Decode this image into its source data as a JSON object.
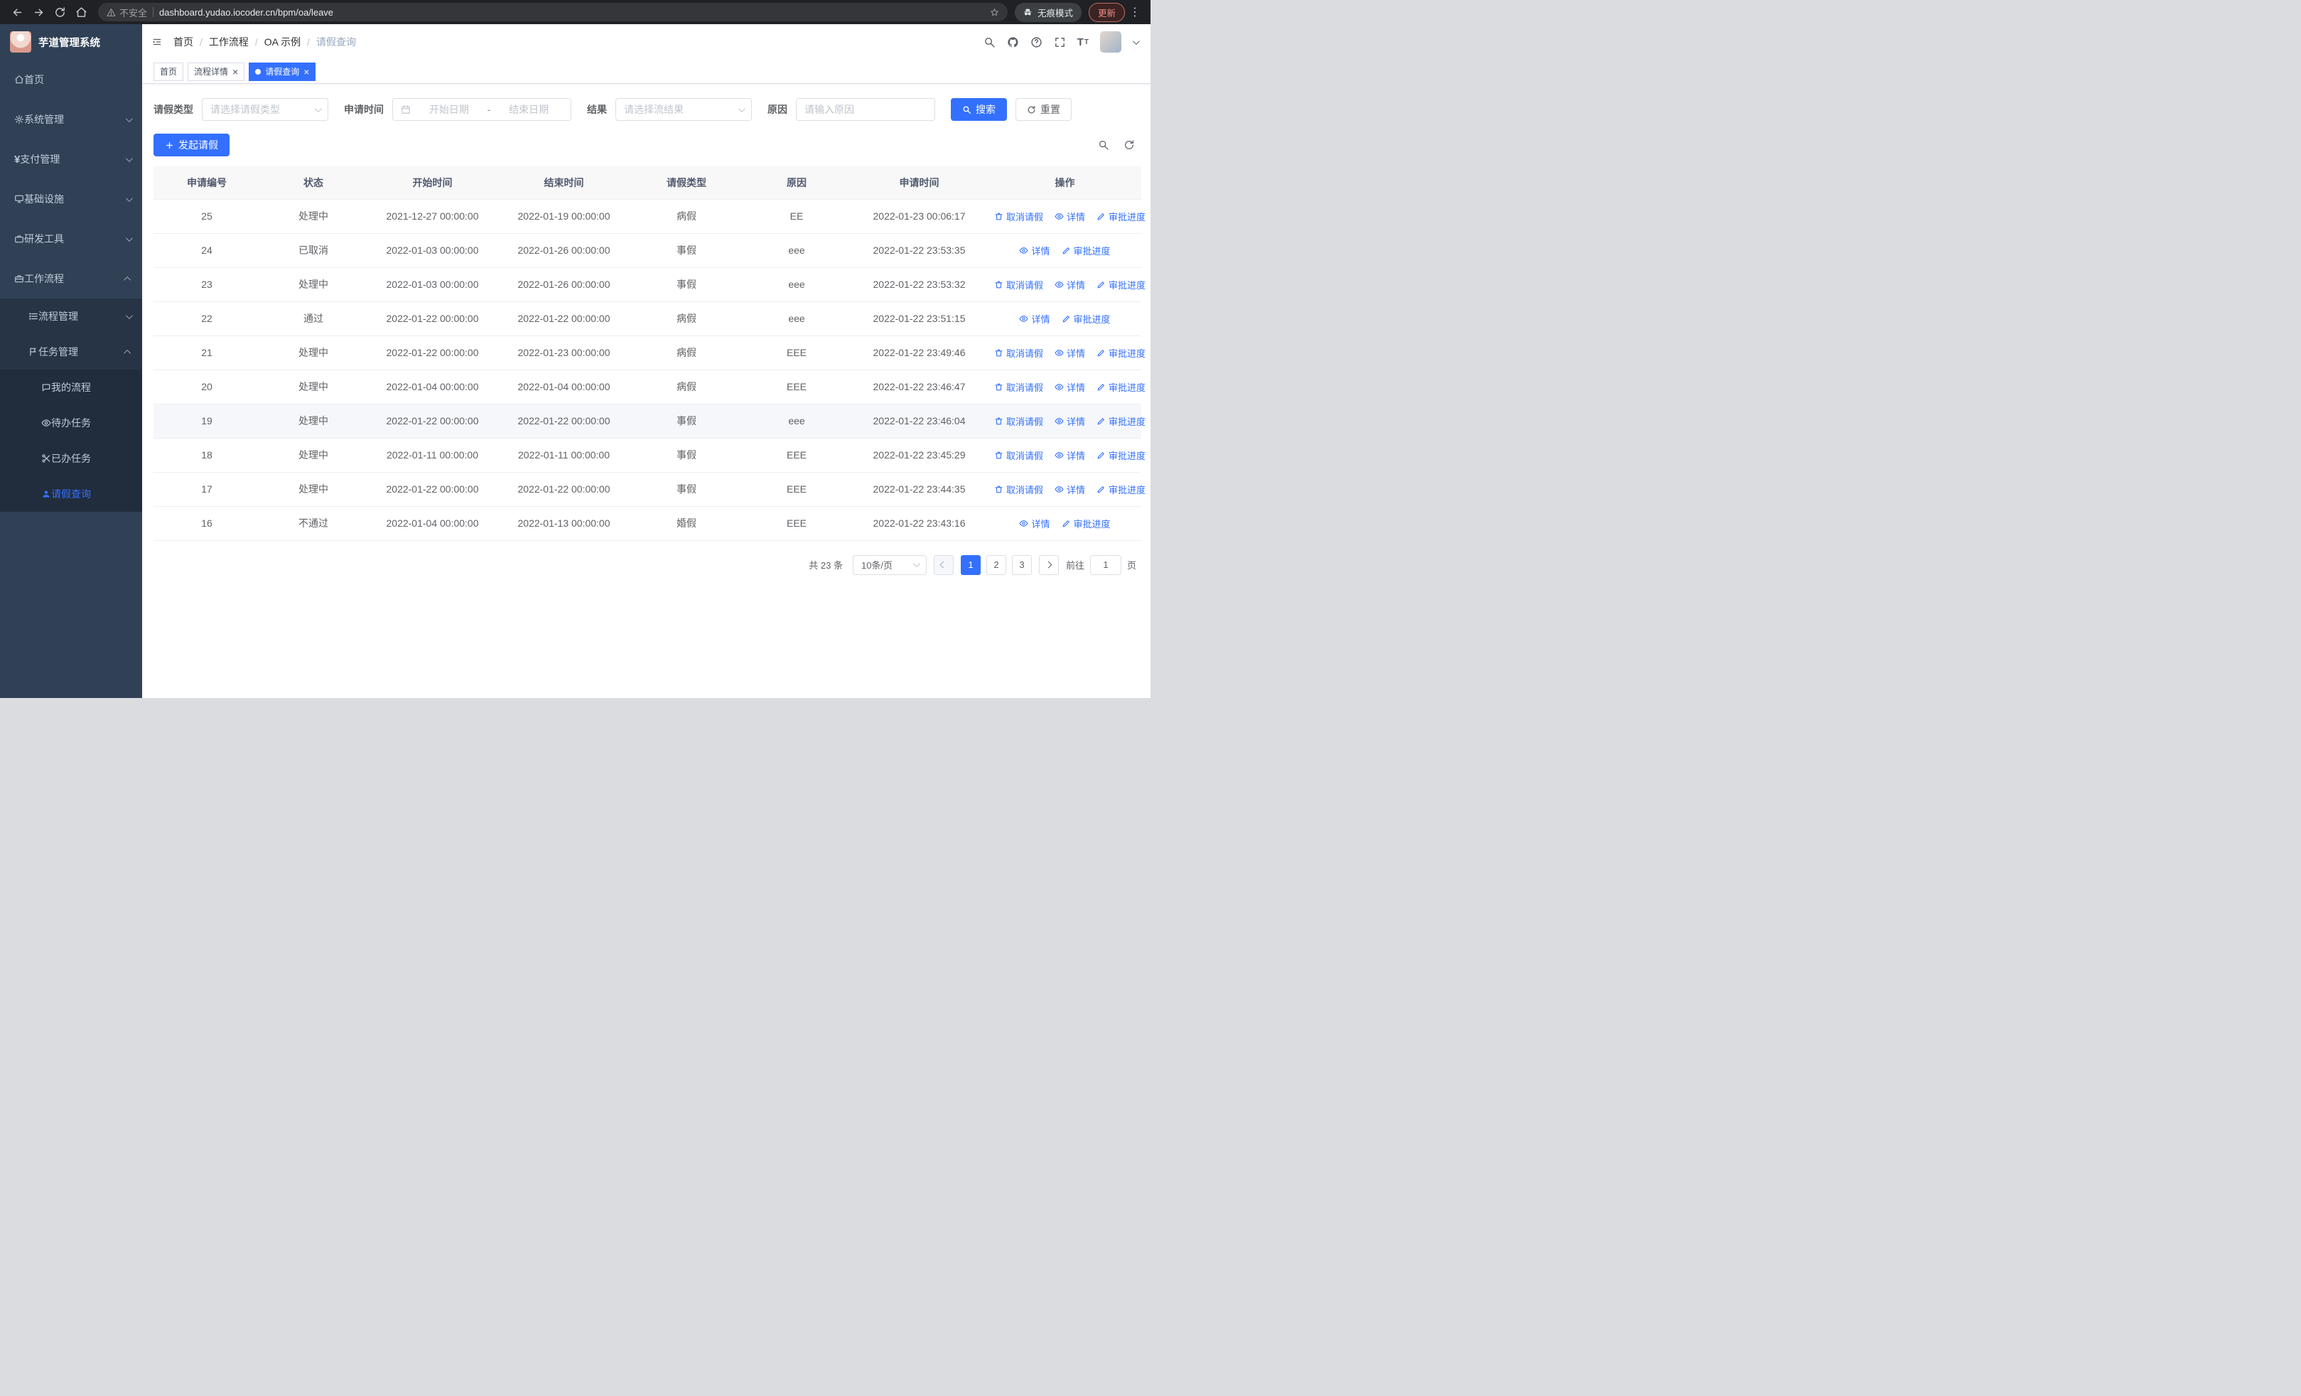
{
  "colors": {
    "primary": "#3370ff"
  },
  "browser": {
    "security_chip": "不安全",
    "url": "dashboard.yudao.iocoder.cn/bpm/oa/leave",
    "incognito_label": "无痕模式",
    "update_button": "更新"
  },
  "sidebar": {
    "logo_title": "芋道管理系统",
    "items": [
      {
        "name": "home",
        "label": "首页",
        "icon": "home-icon",
        "level": 0
      },
      {
        "name": "system-management",
        "label": "系统管理",
        "icon": "gear-icon",
        "level": 0,
        "arrow": "down"
      },
      {
        "name": "payment-management",
        "label": "支付管理",
        "icon": "yen-icon",
        "level": 0,
        "arrow": "down"
      },
      {
        "name": "infrastructure",
        "label": "基础设施",
        "icon": "monitor-icon",
        "level": 0,
        "arrow": "down"
      },
      {
        "name": "dev-tools",
        "label": "研发工具",
        "icon": "toolbox-icon",
        "level": 0,
        "arrow": "down"
      },
      {
        "name": "workflow",
        "label": "工作流程",
        "icon": "briefcase-icon",
        "level": 0,
        "arrow": "up"
      },
      {
        "name": "process-management",
        "label": "流程管理",
        "icon": "list-icon",
        "level": 1,
        "arrow": "down"
      },
      {
        "name": "task-management",
        "label": "任务管理",
        "icon": "flag-icon",
        "level": 1,
        "arrow": "up"
      },
      {
        "name": "my-process",
        "label": "我的流程",
        "icon": "chat-icon",
        "level": 2
      },
      {
        "name": "todo-tasks",
        "label": "待办任务",
        "icon": "eye-icon",
        "level": 2
      },
      {
        "name": "done-tasks",
        "label": "已办任务",
        "icon": "scissors-icon",
        "level": 2
      },
      {
        "name": "leave-query",
        "label": "请假查询",
        "icon": "user-icon",
        "level": 2,
        "active": true
      }
    ]
  },
  "navbar": {
    "breadcrumb": [
      "首页",
      "工作流程",
      "OA 示例",
      "请假查询"
    ],
    "icons": [
      "search-icon",
      "github-icon",
      "question-icon",
      "fullscreen-icon",
      "fontsize-icon"
    ]
  },
  "tabs": [
    {
      "name": "tab-home",
      "label": "首页",
      "closable": false,
      "active": false
    },
    {
      "name": "tab-process-detail",
      "label": "流程详情",
      "closable": true,
      "active": false
    },
    {
      "name": "tab-leave-query",
      "label": "请假查询",
      "closable": true,
      "active": true
    }
  ],
  "filters": {
    "leave_type_label": "请假类型",
    "leave_type_placeholder": "请选择请假类型",
    "apply_time_label": "申请时间",
    "start_date_placeholder": "开始日期",
    "range_separator": "-",
    "end_date_placeholder": "结束日期",
    "result_label": "结果",
    "result_placeholder": "请选择流结果",
    "reason_label": "原因",
    "reason_placeholder": "请输入原因",
    "search_button": "搜索",
    "reset_button": "重置"
  },
  "toolbar": {
    "create_button": "发起请假"
  },
  "table": {
    "columns": [
      "申请编号",
      "状态",
      "开始时间",
      "结束时间",
      "请假类型",
      "原因",
      "申请时间",
      "操作"
    ],
    "action_labels": {
      "cancel": "取消请假",
      "detail": "详情",
      "progress": "审批进度"
    },
    "rows": [
      {
        "id": "25",
        "status": "处理中",
        "start": "2021-12-27 00:00:00",
        "end": "2022-01-19 00:00:00",
        "type": "病假",
        "reason": "EE",
        "apply_time": "2022-01-23 00:06:17",
        "actions": [
          "cancel",
          "detail",
          "progress"
        ]
      },
      {
        "id": "24",
        "status": "已取消",
        "start": "2022-01-03 00:00:00",
        "end": "2022-01-26 00:00:00",
        "type": "事假",
        "reason": "eee",
        "apply_time": "2022-01-22 23:53:35",
        "actions": [
          "detail",
          "progress"
        ]
      },
      {
        "id": "23",
        "status": "处理中",
        "start": "2022-01-03 00:00:00",
        "end": "2022-01-26 00:00:00",
        "type": "事假",
        "reason": "eee",
        "apply_time": "2022-01-22 23:53:32",
        "actions": [
          "cancel",
          "detail",
          "progress"
        ]
      },
      {
        "id": "22",
        "status": "通过",
        "start": "2022-01-22 00:00:00",
        "end": "2022-01-22 00:00:00",
        "type": "病假",
        "reason": "eee",
        "apply_time": "2022-01-22 23:51:15",
        "actions": [
          "detail",
          "progress"
        ]
      },
      {
        "id": "21",
        "status": "处理中",
        "start": "2022-01-22 00:00:00",
        "end": "2022-01-23 00:00:00",
        "type": "病假",
        "reason": "EEE",
        "apply_time": "2022-01-22 23:49:46",
        "actions": [
          "cancel",
          "detail",
          "progress"
        ]
      },
      {
        "id": "20",
        "status": "处理中",
        "start": "2022-01-04 00:00:00",
        "end": "2022-01-04 00:00:00",
        "type": "病假",
        "reason": "EEE",
        "apply_time": "2022-01-22 23:46:47",
        "actions": [
          "cancel",
          "detail",
          "progress"
        ]
      },
      {
        "id": "19",
        "status": "处理中",
        "start": "2022-01-22 00:00:00",
        "end": "2022-01-22 00:00:00",
        "type": "事假",
        "reason": "eee",
        "apply_time": "2022-01-22 23:46:04",
        "actions": [
          "cancel",
          "detail",
          "progress"
        ],
        "highlight": true
      },
      {
        "id": "18",
        "status": "处理中",
        "start": "2022-01-11 00:00:00",
        "end": "2022-01-11 00:00:00",
        "type": "事假",
        "reason": "EEE",
        "apply_time": "2022-01-22 23:45:29",
        "actions": [
          "cancel",
          "detail",
          "progress"
        ]
      },
      {
        "id": "17",
        "status": "处理中",
        "start": "2022-01-22 00:00:00",
        "end": "2022-01-22 00:00:00",
        "type": "事假",
        "reason": "EEE",
        "apply_time": "2022-01-22 23:44:35",
        "actions": [
          "cancel",
          "detail",
          "progress"
        ]
      },
      {
        "id": "16",
        "status": "不通过",
        "start": "2022-01-04 00:00:00",
        "end": "2022-01-13 00:00:00",
        "type": "婚假",
        "reason": "EEE",
        "apply_time": "2022-01-22 23:43:16",
        "actions": [
          "detail",
          "progress"
        ]
      }
    ]
  },
  "pagination": {
    "total_text": "共 23 条",
    "page_size": "10条/页",
    "pages": [
      "1",
      "2",
      "3"
    ],
    "active_page": "1",
    "goto_label": "前往",
    "goto_value": "1",
    "goto_suffix": "页"
  }
}
